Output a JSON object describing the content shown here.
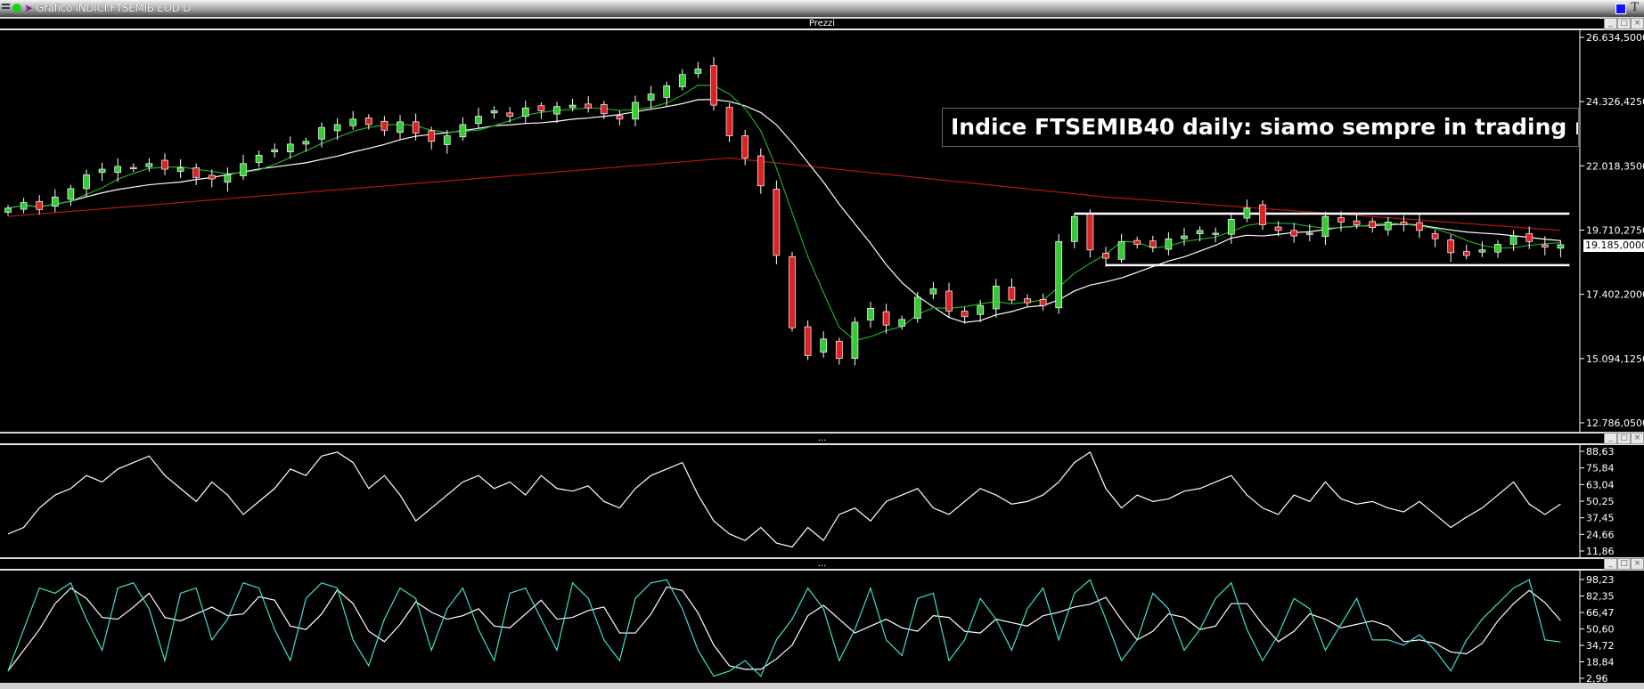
{
  "window": {
    "title": "Grafico INDICI.FTSEMIB EOD D",
    "tool_label": "T"
  },
  "panels": {
    "price_header": "Prezzi",
    "rsi_header": "...",
    "stoch_header": "..."
  },
  "annotation": "Indice FTSEMIB40 daily: siamo sempre in trading range",
  "last_price_label": "19.185,0000",
  "colors": {
    "up": "#33cc33",
    "down": "#dd2222",
    "ma_fast": "#22aa22",
    "ma_slow": "#ffffff",
    "ma_long": "#b01818",
    "stoch_k": "#40e0d0",
    "stoch_d": "#ffffff"
  },
  "chart_data": [
    {
      "type": "candlestick",
      "title": "Prezzi",
      "ylim": [
        12786.05,
        26634.5
      ],
      "y_ticks": [
        {
          "value": 26634.5,
          "label": "26.634,5000"
        },
        {
          "value": 24326.425,
          "label": "24.326,4250"
        },
        {
          "value": 22018.35,
          "label": "22.018,3500"
        },
        {
          "value": 19710.275,
          "label": "19.710,2750"
        },
        {
          "value": 17402.2,
          "label": "17.402,2000"
        },
        {
          "value": 15094.125,
          "label": "15.094,1250"
        },
        {
          "value": 12786.05,
          "label": "12.786,0500"
        }
      ],
      "closes": [
        20500,
        20700,
        20450,
        20900,
        21200,
        21700,
        21900,
        22000,
        21950,
        22100,
        21900,
        21950,
        21600,
        21550,
        21700,
        22100,
        22400,
        22600,
        22800,
        22900,
        23400,
        23500,
        23700,
        23500,
        23300,
        23600,
        23200,
        22900,
        23100,
        23500,
        23800,
        24000,
        23800,
        24100,
        24000,
        24150,
        24200,
        24100,
        23900,
        23700,
        24300,
        24600,
        24900,
        25300,
        25500,
        24200,
        23100,
        22300,
        21300,
        18800,
        16200,
        15200,
        15800,
        15100,
        16400,
        16900,
        16300,
        16500,
        17300,
        17600,
        16800,
        16600,
        17000,
        17700,
        17200,
        17100,
        17000,
        19300,
        20200,
        19000,
        18700,
        19300,
        19200,
        19100,
        19400,
        19500,
        19700,
        19600,
        20100,
        20500,
        19900,
        19700,
        19500,
        19600,
        20200,
        20000,
        19900,
        19800,
        20000,
        19900,
        19700,
        19400,
        18900,
        18800,
        19000,
        19200,
        19500,
        19300,
        19100,
        19185
      ],
      "long_ma_anchors": [
        [
          0,
          20200
        ],
        [
          46,
          22300
        ],
        [
          70,
          20900
        ],
        [
          99,
          19700
        ]
      ],
      "range_lines": [
        {
          "price": 20300,
          "from_bar": 68,
          "to_bar": 99
        },
        {
          "price": 18450,
          "from_bar": 70,
          "to_bar": 99
        }
      ]
    },
    {
      "type": "line",
      "title": "RSI",
      "ylim": [
        11.86,
        88.63
      ],
      "y_ticks": [
        {
          "value": 88.63,
          "label": "88,63"
        },
        {
          "value": 75.84,
          "label": "75,84"
        },
        {
          "value": 63.04,
          "label": "63,04"
        },
        {
          "value": 50.25,
          "label": "50,25"
        },
        {
          "value": 37.45,
          "label": "37,45"
        },
        {
          "value": 24.66,
          "label": "24,66"
        },
        {
          "value": 11.86,
          "label": "11,86"
        }
      ],
      "values": [
        25,
        30,
        45,
        55,
        60,
        70,
        65,
        75,
        80,
        85,
        70,
        60,
        50,
        65,
        55,
        40,
        50,
        60,
        75,
        70,
        85,
        88,
        80,
        60,
        70,
        55,
        35,
        45,
        55,
        65,
        70,
        60,
        65,
        55,
        70,
        60,
        58,
        62,
        50,
        45,
        60,
        70,
        75,
        80,
        55,
        35,
        25,
        20,
        30,
        18,
        15,
        30,
        20,
        40,
        45,
        35,
        50,
        55,
        60,
        45,
        40,
        50,
        60,
        55,
        48,
        50,
        55,
        65,
        80,
        88,
        60,
        45,
        55,
        50,
        52,
        58,
        60,
        65,
        70,
        55,
        45,
        40,
        55,
        50,
        65,
        52,
        48,
        50,
        45,
        42,
        50,
        40,
        30,
        38,
        45,
        55,
        65,
        48,
        40,
        48
      ]
    },
    {
      "type": "line",
      "title": "Stocastico",
      "ylim": [
        2.96,
        98.23
      ],
      "y_ticks": [
        {
          "value": 98.23,
          "label": "98,23"
        },
        {
          "value": 82.35,
          "label": "82,35"
        },
        {
          "value": 66.47,
          "label": "66,47"
        },
        {
          "value": 50.6,
          "label": "50,60"
        },
        {
          "value": 34.72,
          "label": "34,72"
        },
        {
          "value": 18.84,
          "label": "18,84"
        },
        {
          "value": 2.96,
          "label": "2,96"
        }
      ],
      "k_values": [
        10,
        50,
        90,
        85,
        95,
        60,
        30,
        90,
        95,
        70,
        20,
        85,
        90,
        40,
        60,
        95,
        90,
        50,
        20,
        80,
        95,
        90,
        40,
        15,
        60,
        90,
        80,
        30,
        70,
        90,
        50,
        20,
        85,
        90,
        60,
        30,
        95,
        80,
        40,
        20,
        80,
        95,
        98,
        70,
        30,
        5,
        10,
        20,
        5,
        40,
        60,
        90,
        70,
        20,
        50,
        90,
        40,
        25,
        80,
        85,
        20,
        40,
        80,
        60,
        30,
        70,
        90,
        40,
        85,
        98,
        60,
        20,
        40,
        85,
        70,
        30,
        50,
        80,
        95,
        50,
        20,
        45,
        80,
        70,
        30,
        55,
        80,
        40,
        40,
        35,
        45,
        30,
        10,
        40,
        60,
        75,
        90,
        98,
        40,
        38
      ]
    }
  ]
}
